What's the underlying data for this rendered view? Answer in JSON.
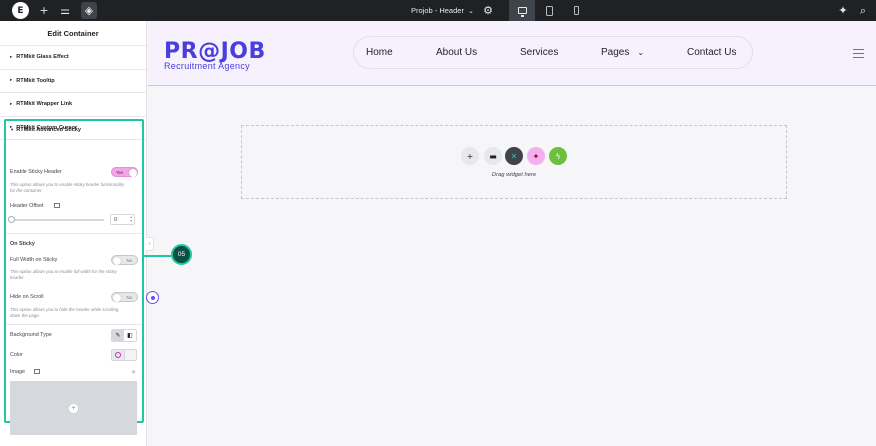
{
  "topbar": {
    "title": "Projob - Header",
    "icons": [
      "elementor-logo-icon",
      "add-icon",
      "settings-sliders-icon",
      "layers-icon",
      "chevron-down-icon",
      "gear-icon",
      "desktop-icon",
      "tablet-icon",
      "mobile-icon",
      "rocket-icon",
      "search-icon"
    ],
    "logo_letter": "E"
  },
  "panel": {
    "header": "Edit Container",
    "sections": [
      {
        "label": "RTMkit Glass Effect"
      },
      {
        "label": "RTMkit Tooltip"
      },
      {
        "label": "RTMkit Wrapper Link"
      },
      {
        "label": "RTMkit Custom Cursor"
      }
    ],
    "advanced": {
      "title": "RTMkit Advanced Sticky",
      "enable_label": "Enable Sticky Header",
      "enable_state": "Yes",
      "enable_hint": "This option allows you to enable sticky header functionality for the container.",
      "offset_label": "Header Offset",
      "offset_value": "0",
      "on_sticky_label": "On Sticky",
      "full_width_label": "Full Width on Sticky",
      "full_width_state": "No",
      "full_width_hint": "This option allows you to enable full width for the sticky header.",
      "hide_scroll_label": "Hide on Scroll",
      "hide_scroll_state": "No",
      "hide_scroll_hint": "This option allows you to hide the header while scrolling down the page.",
      "bg_type_label": "Background Type",
      "color_label": "Color",
      "image_label": "Image"
    }
  },
  "callout": {
    "number": "05"
  },
  "site": {
    "logo": "PR@JOB",
    "tagline": "Recruitment Agency",
    "nav": [
      "Home",
      "About Us",
      "Services",
      "Pages",
      "Contact Us"
    ]
  },
  "dropzone": {
    "label": "Drag widget here"
  },
  "colors": {
    "accent": "#1ec8a0",
    "brand": "#4a3fdb",
    "toggle_on": "#f0a6e8",
    "topbar": "#1f2124"
  }
}
